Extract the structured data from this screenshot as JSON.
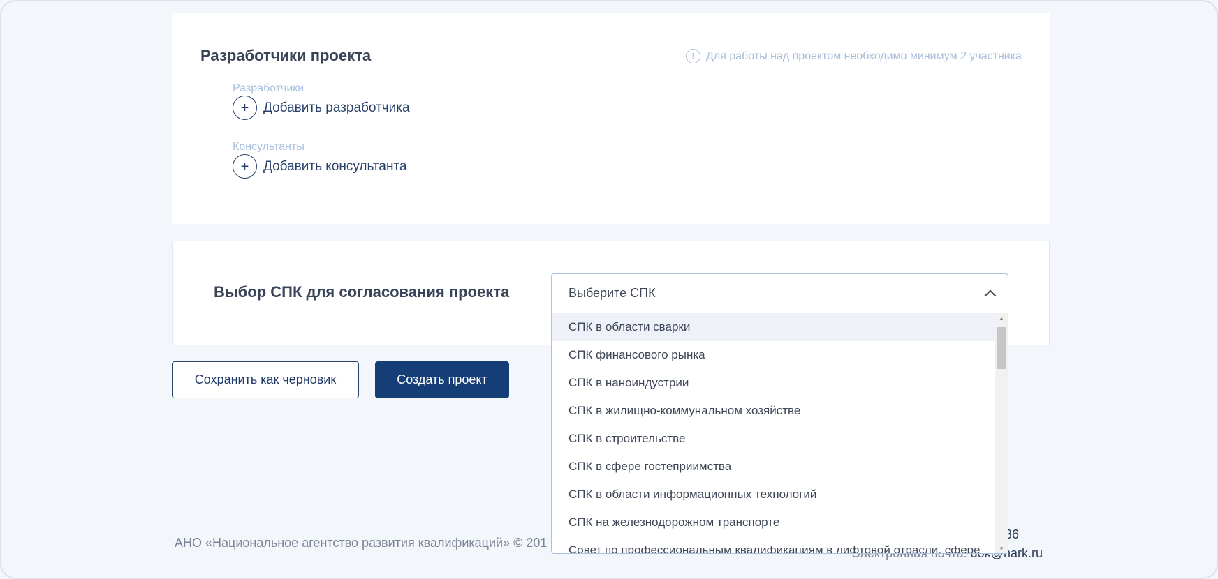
{
  "developers_card": {
    "title": "Разработчики проекта",
    "notice": "Для работы над проектом необходимо минимум 2 участника",
    "developers_label": "Разработчики",
    "add_developer": "Добавить разработчика",
    "consultants_label": "Консультанты",
    "add_consultant": "Добавить консультанта"
  },
  "spk_card": {
    "title": "Выбор СПК для согласования проекта",
    "select_placeholder": "Выберите СПК",
    "options": [
      "СПК в области сварки",
      "СПК финансового рынка",
      "СПК в наноиндустрии",
      "СПК в жилищно-коммунальном хозяйстве",
      "СПК в строительстве",
      "СПК в сфере гостеприимства",
      "СПК в области информационных технологий",
      "СПК на железнодорожном транспорте",
      "Совет по профессиональным квалификациям в лифтовой отрасли, сфере"
    ]
  },
  "actions": {
    "save_draft": "Сохранить как черновик",
    "create_project": "Создать проект"
  },
  "footer": {
    "org": "АНО «Национальное агентство развития квалификаций» © 201",
    "phone_fragment": "36",
    "email_label": "Электронная почта:",
    "email": "dok@nark.ru"
  },
  "colors": {
    "primary": "#153d76",
    "muted_label": "#a9c0e0",
    "background": "#f3f6fb"
  },
  "icons": {
    "info": "info-circle-icon",
    "add": "plus-circle-icon",
    "select_toggle": "chevron-up-icon"
  }
}
